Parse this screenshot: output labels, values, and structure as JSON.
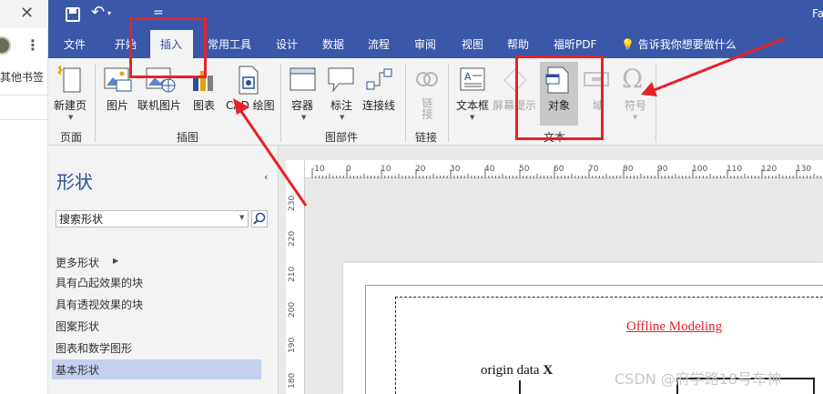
{
  "browser": {
    "close_glyph": "✕",
    "menu_glyph": "⋮",
    "bookmarks_label": "其他书签",
    "avatar_icon": "user-avatar"
  },
  "title_bar": {
    "title": "Fa",
    "background": "#3a57a8",
    "save_icon": "save-icon",
    "undo_icon": "undo-icon",
    "undo_glyph": "↶",
    "dropdown_glyph": "▾",
    "customize_glyph": "="
  },
  "tabs": [
    {
      "label": "文件"
    },
    {
      "label": "开始"
    },
    {
      "label": "插入",
      "active": true
    },
    {
      "label": "常用工具"
    },
    {
      "label": "设计"
    },
    {
      "label": "数据"
    },
    {
      "label": "流程"
    },
    {
      "label": "审阅"
    },
    {
      "label": "视图"
    },
    {
      "label": "帮助"
    },
    {
      "label": "福昕PDF"
    }
  ],
  "tell_me": "告诉我你想要做什么",
  "ribbon": {
    "new_page": "新建页",
    "picture": "图片",
    "online_picture": "联机图片",
    "chart": "图表",
    "cad_drawing": "CAD 绘图",
    "container": "容器",
    "callout": "标注",
    "connector": "连接线",
    "link": "链接",
    "textbox": "文本框",
    "screentip": "屏幕提示",
    "object": "对象",
    "field": "域",
    "symbol": "符号",
    "groups": {
      "pages": "页面",
      "illustrations": "插图",
      "diagram_parts": "图部件",
      "links": "链接",
      "text": "文本"
    }
  },
  "shapes_pane": {
    "title": "形状",
    "collapse_glyph": "‹",
    "search_value": "搜索形状",
    "more_shapes": "更多形状",
    "stencils": [
      "具有凸起效果的块",
      "具有透视效果的块",
      "图案形状",
      "图表和数学图形",
      "基本形状"
    ],
    "active_stencil": "基本形状"
  },
  "ruler": {
    "x_ticks": [
      "-10",
      "0",
      "10",
      "20",
      "30",
      "40",
      "50",
      "60",
      "70",
      "80",
      "90",
      "100",
      "110",
      "120",
      "130"
    ],
    "y_ticks": [
      "230",
      "220",
      "210",
      "200",
      "190",
      "180"
    ]
  },
  "diagram": {
    "offline_label": "Offline Modeling",
    "origin_label": "origin data",
    "origin_var": "X"
  },
  "watermark": "CSDN @府学路18号车神",
  "colors": {
    "accent": "#3a57a8",
    "highlight_red": "#e8202a",
    "offline_text": "#e01f26",
    "active_stencil_bg": "#c5d0ef"
  }
}
